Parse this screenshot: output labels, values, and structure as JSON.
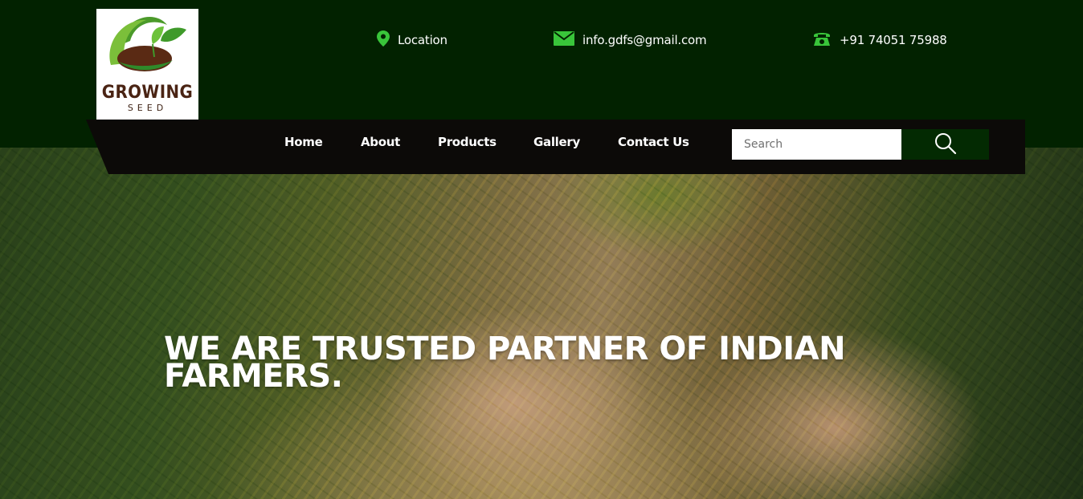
{
  "brand": {
    "logo_text_main": "GROWING",
    "logo_text_sub": "SEED"
  },
  "contact": {
    "location": {
      "icon": "map-pin-icon",
      "text": "Location"
    },
    "email": {
      "icon": "envelope-icon",
      "text": "info.gdfs@gmail.com"
    },
    "phone": {
      "icon": "telephone-icon",
      "text": "+91 74051 75988"
    }
  },
  "nav": {
    "items": [
      {
        "label": "Home"
      },
      {
        "label": "About"
      },
      {
        "label": "Products"
      },
      {
        "label": "Gallery"
      },
      {
        "label": "Contact Us"
      }
    ]
  },
  "search": {
    "placeholder": "Search",
    "value": "",
    "button_icon": "search-icon"
  },
  "hero": {
    "heading": "WE ARE TRUSTED PARTNER OF INDIAN FARMERS."
  },
  "colors": {
    "header_bg": "#022200",
    "nav_bg": "#0c0a08",
    "accent_green": "#39c53a",
    "search_button_bg": "#032a02",
    "logo_brown": "#4a2414"
  }
}
